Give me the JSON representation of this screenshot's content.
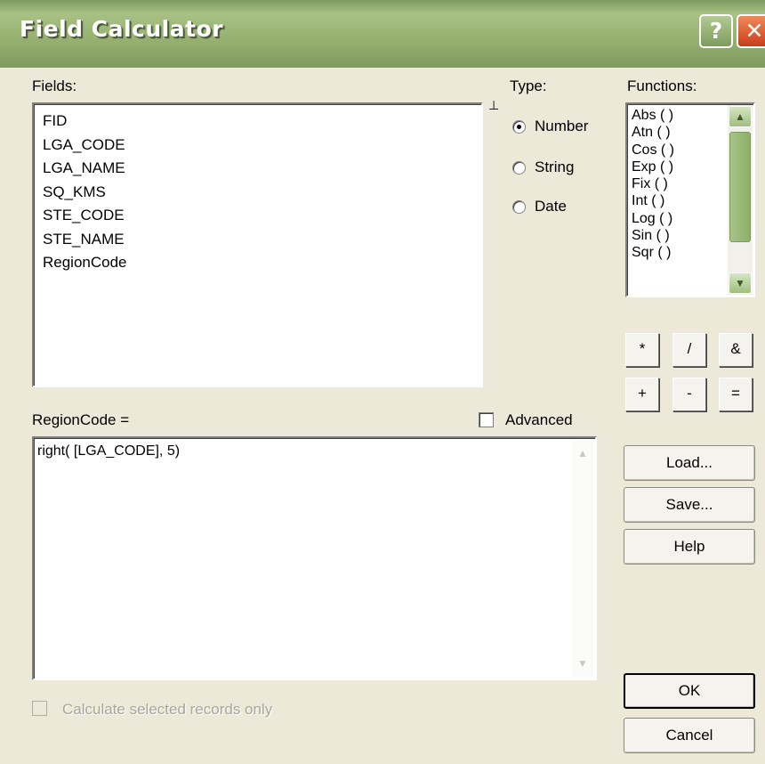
{
  "window": {
    "title": "Field Calculator",
    "help_glyph": "?",
    "close_glyph": "✕"
  },
  "fields": {
    "label": "Fields:",
    "items": [
      "FID",
      "LGA_CODE",
      "LGA_NAME",
      "SQ_KMS",
      "STE_CODE",
      "STE_NAME",
      "RegionCode"
    ]
  },
  "type": {
    "label": "Type:",
    "options": [
      "Number",
      "String",
      "Date"
    ],
    "selected": "Number"
  },
  "functions": {
    "label": "Functions:",
    "items": [
      "Abs ( )",
      "Atn ( )",
      "Cos ( )",
      "Exp ( )",
      "Fix ( )",
      "Int ( )",
      "Log ( )",
      "Sin ( )",
      "Sqr ( )"
    ]
  },
  "operators": [
    "*",
    "/",
    "&",
    "+",
    "-",
    "="
  ],
  "expression": {
    "label": "RegionCode =",
    "value": "right( [LGA_CODE], 5)",
    "advanced_label": "Advanced",
    "advanced_checked": false
  },
  "calc_selected": {
    "label": "Calculate selected records only",
    "enabled": false
  },
  "buttons": {
    "load": "Load...",
    "save": "Save...",
    "help": "Help",
    "ok": "OK",
    "cancel": "Cancel"
  }
}
